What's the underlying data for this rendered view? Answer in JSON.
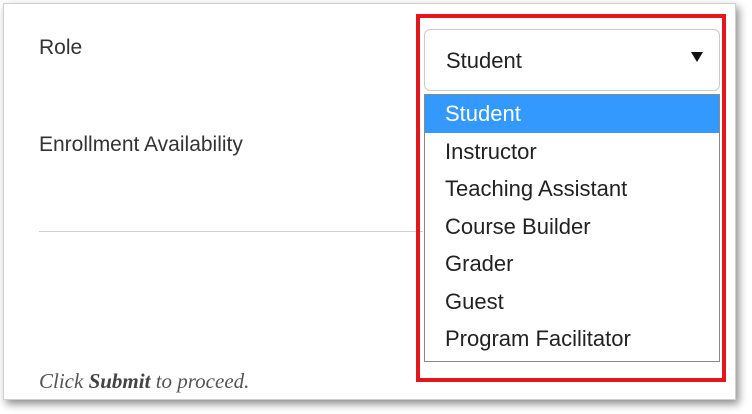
{
  "form": {
    "role_label": "Role",
    "enrollment_label": "Enrollment Availability",
    "instruction_prefix": "Click",
    "instruction_bold": "Submit",
    "instruction_suffix": "to proceed."
  },
  "role_select": {
    "value": "Student",
    "options": [
      "Student",
      "Instructor",
      "Teaching Assistant",
      "Course Builder",
      "Grader",
      "Guest",
      "Program Facilitator"
    ],
    "highlighted_index": 0
  },
  "colors": {
    "highlight_outline": "#e3161d",
    "selected_option_bg": "#3399ff"
  },
  "icons": {
    "dropdown_caret": "caret-down-icon"
  }
}
